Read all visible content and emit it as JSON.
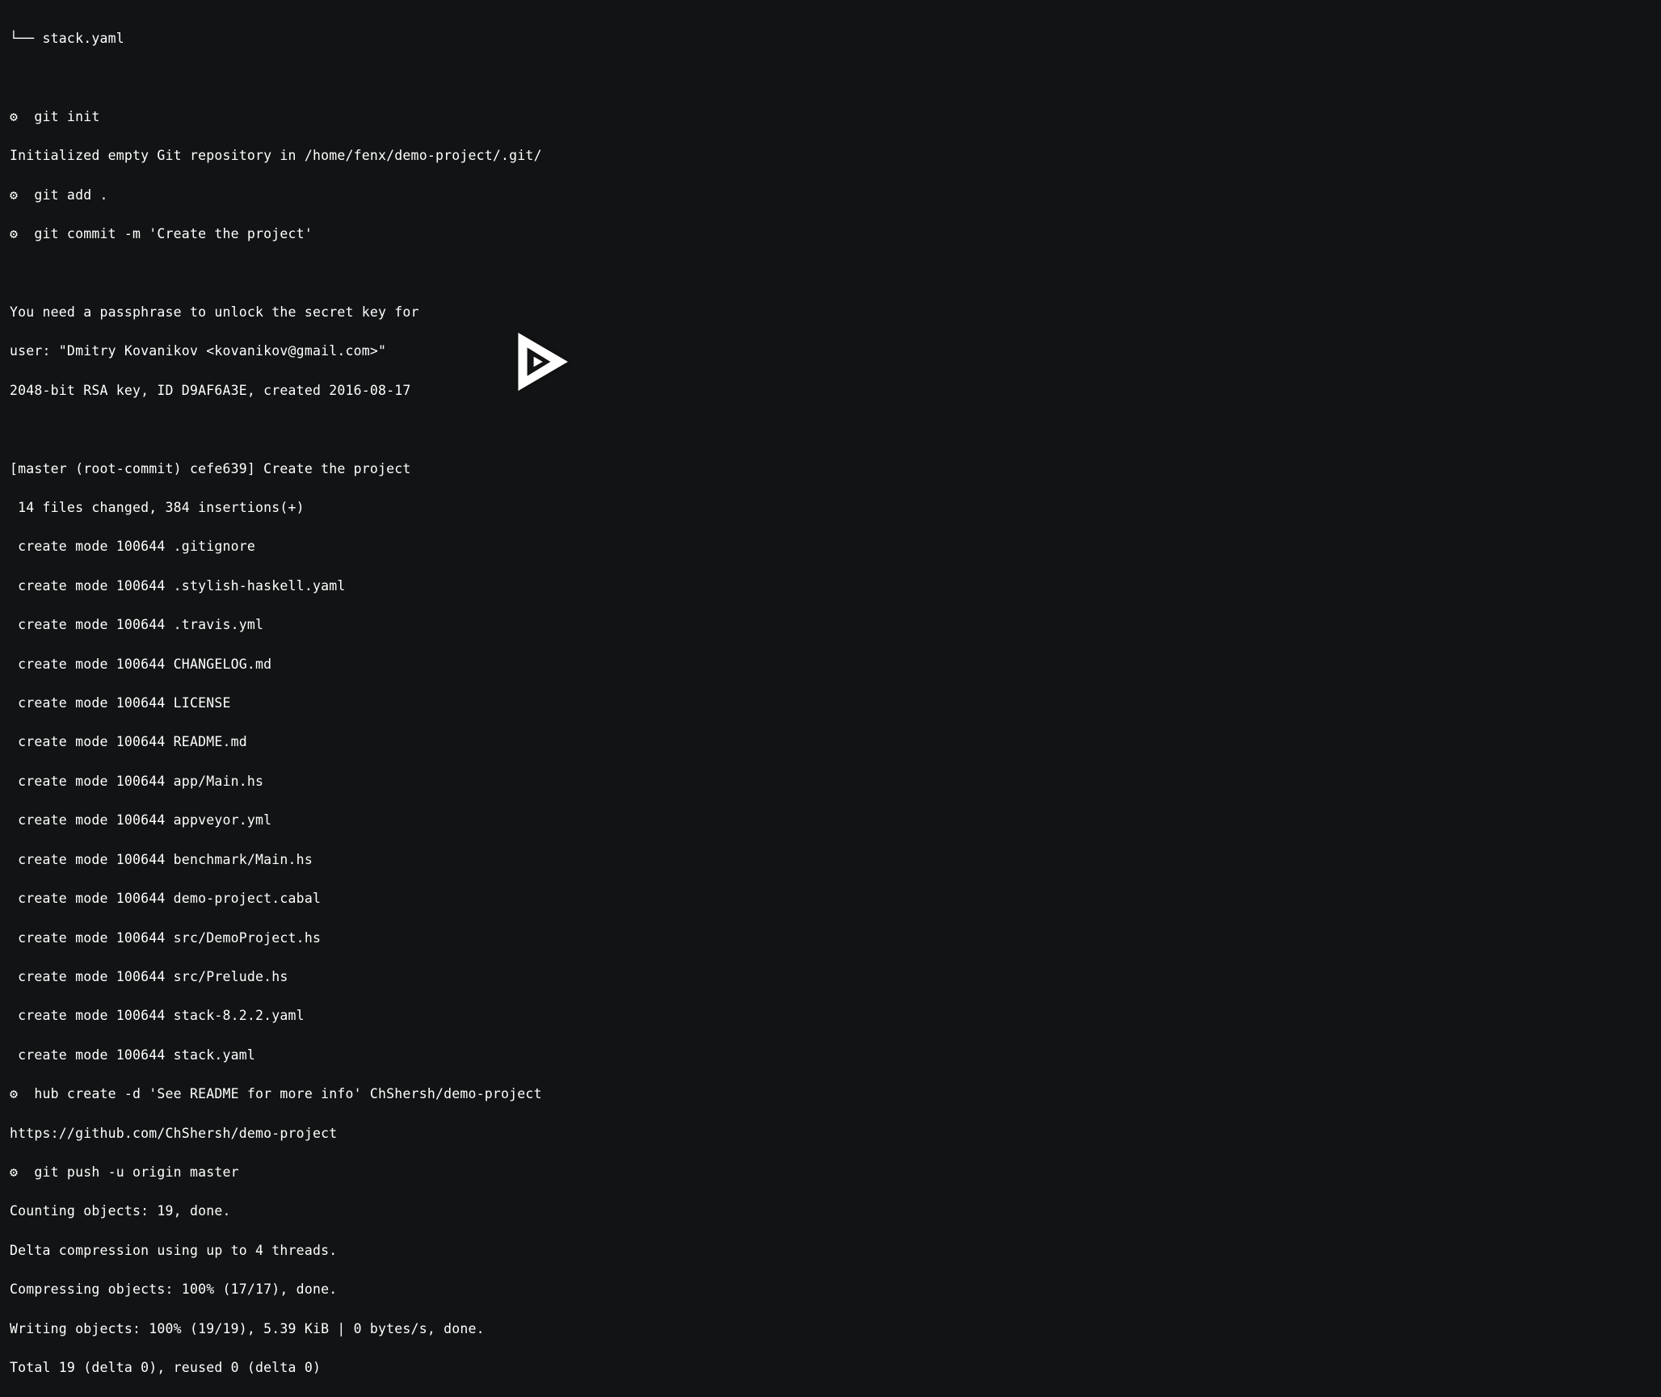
{
  "tree_prefix": "└── ",
  "tree_file": "stack.yaml",
  "prompt_symbol": "⚙",
  "lines": {
    "l1": "└── stack.yaml",
    "l2": "",
    "l3_prompt": "⚙  git init",
    "l4": "Initialized empty Git repository in /home/fenx/demo-project/.git/",
    "l5_prompt": "⚙  git add .",
    "l6_prompt": "⚙  git commit -m 'Create the project'",
    "l7": "",
    "l8": "You need a passphrase to unlock the secret key for",
    "l9": "user: \"Dmitry Kovanikov <kovanikov@gmail.com>\"",
    "l10": "2048-bit RSA key, ID D9AF6A3E, created 2016-08-17",
    "l11": "",
    "l12": "[master (root-commit) cefe639] Create the project",
    "l13": " 14 files changed, 384 insertions(+)",
    "l14": " create mode 100644 .gitignore",
    "l15": " create mode 100644 .stylish-haskell.yaml",
    "l16": " create mode 100644 .travis.yml",
    "l17": " create mode 100644 CHANGELOG.md",
    "l18": " create mode 100644 LICENSE",
    "l19": " create mode 100644 README.md",
    "l20": " create mode 100644 app/Main.hs",
    "l21": " create mode 100644 appveyor.yml",
    "l22": " create mode 100644 benchmark/Main.hs",
    "l23": " create mode 100644 demo-project.cabal",
    "l24": " create mode 100644 src/DemoProject.hs",
    "l25": " create mode 100644 src/Prelude.hs",
    "l26": " create mode 100644 stack-8.2.2.yaml",
    "l27": " create mode 100644 stack.yaml",
    "l28_prompt": "⚙  hub create -d 'See README for more info' ChShersh/demo-project",
    "l29": "https://github.com/ChShersh/demo-project",
    "l30_prompt": "⚙  git push -u origin master",
    "l31": "Counting objects: 19, done.",
    "l32": "Delta compression using up to 4 threads.",
    "l33": "Compressing objects: 100% (17/17), done.",
    "l34": "Writing objects: 100% (19/19), 5.39 KiB | 0 bytes/s, done.",
    "l35": "Total 19 (delta 0), reused 0 (delta 0)"
  }
}
